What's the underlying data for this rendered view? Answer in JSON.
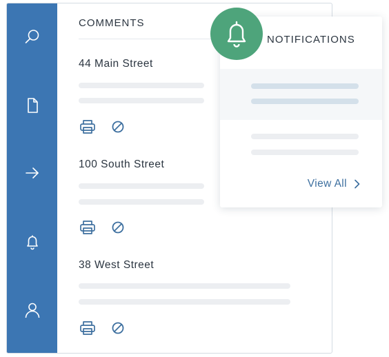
{
  "colors": {
    "sidebar": "#3c76b3",
    "accent_icon": "#3d6f9f",
    "badge": "#4ea47b",
    "placeholder": "#eceef1",
    "placeholder_highlight": "#d4e0ea"
  },
  "sidebar": {
    "items": [
      {
        "icon": "search-icon"
      },
      {
        "icon": "document-icon"
      },
      {
        "icon": "arrow-right-icon"
      },
      {
        "icon": "bell-icon"
      },
      {
        "icon": "user-icon"
      }
    ]
  },
  "comments": {
    "heading": "COMMENTS",
    "items": [
      {
        "title": "44 Main Street",
        "actions": [
          "print-icon",
          "ban-icon"
        ]
      },
      {
        "title": "100 South Street",
        "actions": [
          "print-icon",
          "ban-icon"
        ]
      },
      {
        "title": "38 West Street",
        "actions": [
          "print-icon",
          "ban-icon"
        ]
      }
    ]
  },
  "notifications": {
    "title": "NOTIFICATIONS",
    "view_all": "View All",
    "badge_icon": "bell-icon"
  }
}
